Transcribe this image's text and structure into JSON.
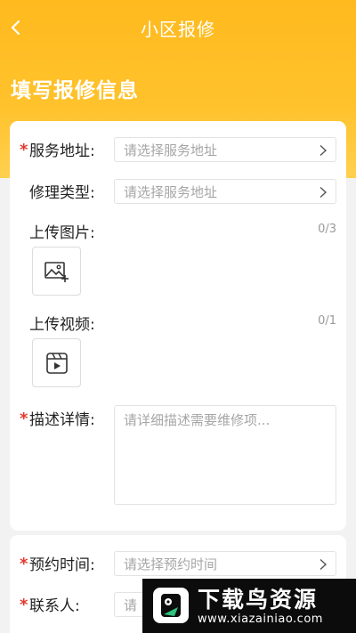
{
  "nav": {
    "title": "小区报修",
    "back_icon": "chevron-left-icon"
  },
  "section_title": "填写报修信息",
  "form": {
    "address": {
      "required_mark": "*",
      "label": "服务地址:",
      "placeholder": "请选择服务地址"
    },
    "repair_type": {
      "label": "修理类型:",
      "placeholder": "请选择服务地址"
    },
    "upload_image": {
      "label": "上传图片:",
      "count": "0/3",
      "icon": "add-image-icon"
    },
    "upload_video": {
      "label": "上传视频:",
      "count": "0/1",
      "icon": "video-icon"
    },
    "description": {
      "required_mark": "*",
      "label": "描述详情:",
      "placeholder": "请详细描述需要维修项..."
    }
  },
  "form2": {
    "appointment": {
      "required_mark": "*",
      "label": "预约时间:",
      "placeholder": "请选择预约时间"
    },
    "contact": {
      "required_mark": "*",
      "label": "联系人:",
      "placeholder": "请"
    }
  },
  "watermark": {
    "title": "下载鸟资源",
    "url": "www.xiazainiao.com"
  },
  "colors": {
    "accent": "#ffba1e",
    "required": "#e13a2f",
    "placeholder": "#a6a6a6"
  }
}
